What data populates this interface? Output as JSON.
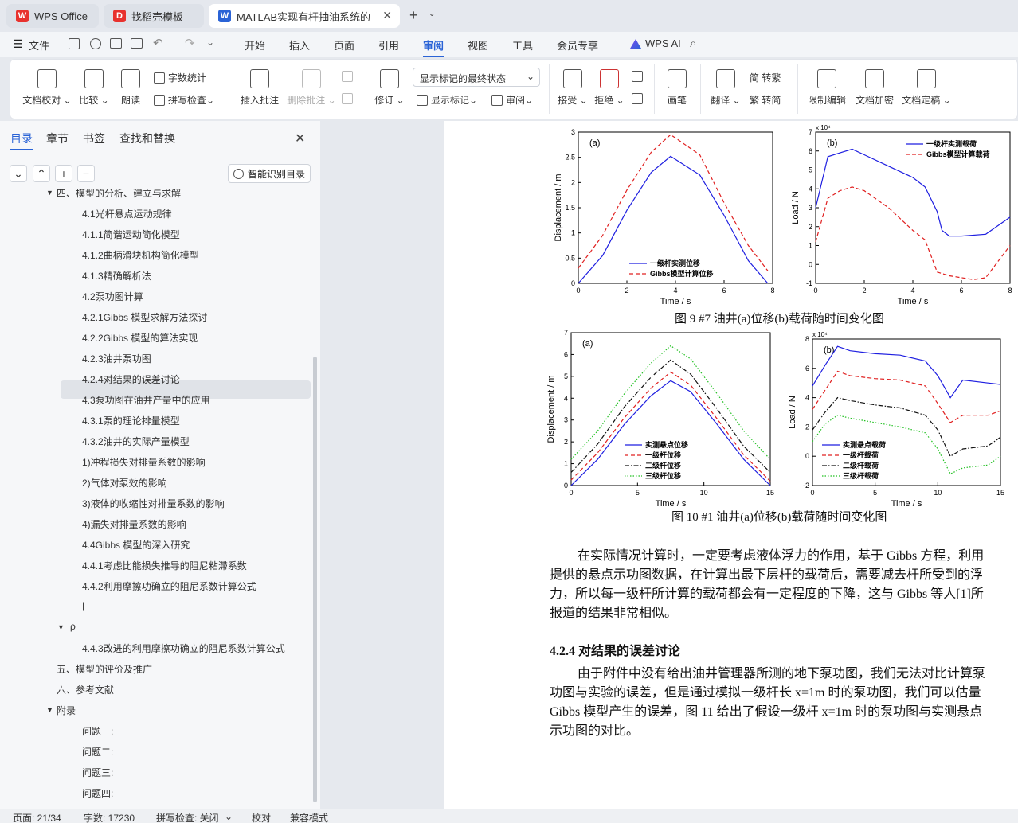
{
  "tabs": [
    {
      "label": "WPS Office",
      "icon": "wps-logo-icon",
      "color": "#e8322e"
    },
    {
      "label": "找稻壳模板",
      "icon": "docer-icon",
      "color": "#e8322e"
    },
    {
      "label": "MATLAB实现有杆抽油系统的",
      "icon": "word-doc-icon",
      "color": "#2a63d6"
    }
  ],
  "menu": {
    "file": "文件",
    "items": [
      "开始",
      "插入",
      "页面",
      "引用",
      "审阅",
      "视图",
      "工具",
      "会员专享"
    ],
    "active": "审阅",
    "ai": "WPS AI"
  },
  "ribbon": {
    "doc_proof": "文档校对",
    "compare": "比较",
    "read_aloud": "朗读",
    "word_count": "字数统计",
    "spell_check": "拼写检查",
    "insert_comment": "插入批注",
    "delete_comment": "删除批注",
    "track": "修订",
    "markup_state": "显示标记的最终状态",
    "show_markup": "显示标记",
    "review": "审阅",
    "accept": "接受",
    "reject": "拒绝",
    "pen": "画笔",
    "translate": "翻译",
    "to_traditional": "简 转繁",
    "to_simplified": "繁 转简",
    "restrict": "限制编辑",
    "encrypt": "文档加密",
    "finalize": "文档定稿"
  },
  "sidebar": {
    "tabs": [
      "目录",
      "章节",
      "书签",
      "查找和替换"
    ],
    "active_tab": "目录",
    "smart_toc": "智能识别目录",
    "items": [
      {
        "label": "四、模型的分析、建立与求解",
        "level": 1,
        "caret": true
      },
      {
        "label": "4.1光杆悬点运动规律",
        "level": 2
      },
      {
        "label": "4.1.1简谐运动简化模型",
        "level": 2
      },
      {
        "label": "4.1.2曲柄滑块机构简化模型",
        "level": 2
      },
      {
        "label": "4.1.3精确解析法",
        "level": 2
      },
      {
        "label": "4.2泵功图计算",
        "level": 2
      },
      {
        "label": "4.2.1Gibbs 模型求解方法探讨",
        "level": 2,
        "selected": true
      },
      {
        "label": "4.2.2Gibbs 模型的算法实现",
        "level": 2
      },
      {
        "label": "4.2.3油井泵功图",
        "level": 2
      },
      {
        "label": "4.2.4对结果的误差讨论",
        "level": 2
      },
      {
        "label": "4.3泵功图在油井产量中的应用",
        "level": 2
      },
      {
        "label": "4.3.1泵的理论排量模型",
        "level": 2
      },
      {
        "label": "4.3.2油井的实际产量模型",
        "level": 2
      },
      {
        "label": "1)冲程损失对排量系数的影响",
        "level": 2
      },
      {
        "label": "2)气体对泵效的影响",
        "level": 2
      },
      {
        "label": "3)液体的收缩性对排量系数的影响",
        "level": 2
      },
      {
        "label": "4)漏失对排量系数的影响",
        "level": 2
      },
      {
        "label": "4.4Gibbs 模型的深入研究",
        "level": 2
      },
      {
        "label": "4.4.1考虑比能损失推导的阻尼粘滞系数",
        "level": 2
      },
      {
        "label": "4.4.2利用摩擦功确立的阻尼系数计算公式",
        "level": 2
      },
      {
        "label": "|",
        "level": 2
      },
      {
        "label": "ρ",
        "level": 1,
        "caret": true
      },
      {
        "label": "4.4.3改进的利用摩擦功确立的阻尼系数计算公式",
        "level": 2
      },
      {
        "label": "五、模型的评价及推广",
        "level": 1
      },
      {
        "label": "六、参考文献",
        "level": 1
      },
      {
        "label": "附录",
        "level": 1,
        "caret": true
      },
      {
        "label": "问题一:",
        "level": 2
      },
      {
        "label": "问题二:",
        "level": 2
      },
      {
        "label": "问题三:",
        "level": 2
      },
      {
        "label": "问题四:",
        "level": 2
      }
    ]
  },
  "document": {
    "fig9_caption": "图  9 #7 油井(a)位移(b)载荷随时间变化图",
    "fig10_caption": "图  10 #1 油井(a)位移(b)载荷随时间变化图",
    "para1": [
      "在实际情况计算时，一定要考虑液体浮力的作用，基于 Gibbs 方程，利用",
      "提供的悬点示功图数据，在计算出最下层杆的载荷后，需要减去杆所受到的浮",
      "力，所以每一级杆所计算的载荷都会有一定程度的下降，这与 Gibbs 等人[1]所",
      "报道的结果非常相似。"
    ],
    "heading": "4.2.4  对结果的误差讨论",
    "para2": [
      "由于附件中没有给出油井管理器所测的地下泵功图，我们无法对比计算泵",
      "功图与实验的误差，但是通过模拟一级杆长 x=1m 时的泵功图，我们可以估量",
      "Gibbs 模型产生的误差，图  11 给出了假设一级杆 x=1m 时的泵功图与实测悬点",
      "示功图的对比。"
    ]
  },
  "chart_data": [
    {
      "type": "line",
      "title": "(a)",
      "xlabel": "Time / s",
      "ylabel": "Displacement / m",
      "xlim": [
        0,
        8
      ],
      "ylim": [
        0,
        3
      ],
      "xticks": [
        0,
        2,
        4,
        6,
        8
      ],
      "yticks": [
        "0",
        "0.5",
        "1",
        "1.5",
        "2",
        "2.5",
        "3"
      ],
      "legend": "lower-center",
      "series": [
        {
          "name": "一级杆实测位移",
          "color": "#1f1fe0",
          "dash": "solid",
          "x": [
            0,
            1,
            2,
            3,
            3.8,
            5,
            6,
            7,
            7.8
          ],
          "y": [
            0,
            0.55,
            1.45,
            2.2,
            2.52,
            2.15,
            1.35,
            0.45,
            0
          ]
        },
        {
          "name": "Gibbs模型计算位移",
          "color": "#e02020",
          "dash": "dashed",
          "x": [
            0,
            1,
            2,
            3,
            3.8,
            5,
            6,
            7,
            7.8
          ],
          "y": [
            0.3,
            0.95,
            1.85,
            2.6,
            2.95,
            2.55,
            1.6,
            0.75,
            0.25
          ]
        }
      ]
    },
    {
      "type": "line",
      "title": "(b)",
      "xlabel": "Time / s",
      "ylabel": "Load / N",
      "yscale": "x 10^4",
      "xlim": [
        0,
        8
      ],
      "ylim": [
        -1,
        7
      ],
      "xticks": [
        0,
        2,
        4,
        6,
        8
      ],
      "yticks": [
        "-1",
        "0",
        "1",
        "2",
        "3",
        "4",
        "5",
        "6",
        "7"
      ],
      "legend": "top-right",
      "series": [
        {
          "name": "一级杆实测载荷",
          "color": "#1f1fe0",
          "dash": "solid",
          "x": [
            0,
            0.5,
            1,
            1.5,
            2,
            3,
            4,
            4.5,
            5,
            5.2,
            5.5,
            6,
            7,
            8
          ],
          "y": [
            3,
            5.7,
            5.9,
            6.1,
            5.8,
            5.2,
            4.6,
            4.1,
            2.8,
            1.8,
            1.5,
            1.5,
            1.6,
            2.5
          ]
        },
        {
          "name": "Gibbs模型计算载荷",
          "color": "#e02020",
          "dash": "dashed",
          "x": [
            0,
            0.5,
            1,
            1.5,
            2,
            3,
            4,
            4.5,
            5,
            5.5,
            6,
            6.5,
            7,
            8
          ],
          "y": [
            1.2,
            3.5,
            3.9,
            4.1,
            3.9,
            3,
            1.8,
            1.3,
            -0.4,
            -0.6,
            -0.7,
            -0.8,
            -0.7,
            1
          ]
        }
      ]
    },
    {
      "type": "line",
      "title": "(a)",
      "xlabel": "Time / s",
      "ylabel": "Displacement / m",
      "xlim": [
        0,
        15
      ],
      "ylim": [
        0,
        7
      ],
      "xticks": [
        0,
        5,
        10,
        15
      ],
      "yticks": [
        "0",
        "1",
        "2",
        "3",
        "4",
        "5",
        "6",
        "7"
      ],
      "legend": "lower-center",
      "series": [
        {
          "name": "实测悬点位移",
          "color": "#1f1fe0",
          "dash": "solid",
          "x": [
            0,
            2,
            4,
            6,
            7.5,
            9,
            11,
            13,
            15
          ],
          "y": [
            0,
            1.2,
            2.8,
            4.1,
            4.8,
            4.3,
            2.8,
            1.2,
            0
          ]
        },
        {
          "name": "一级杆位移",
          "color": "#e02020",
          "dash": "dashed",
          "x": [
            0,
            2,
            4,
            6,
            7.5,
            9,
            11,
            13,
            15
          ],
          "y": [
            0.25,
            1.5,
            3.1,
            4.45,
            5.2,
            4.6,
            3.05,
            1.4,
            0.2
          ]
        },
        {
          "name": "二级杆位移",
          "color": "#111111",
          "dash": "dashdot",
          "x": [
            0,
            2,
            4,
            6,
            7.5,
            9,
            11,
            13,
            15
          ],
          "y": [
            0.6,
            1.9,
            3.6,
            4.95,
            5.75,
            5.1,
            3.5,
            1.8,
            0.6
          ]
        },
        {
          "name": "三级杆位移",
          "color": "#20c020",
          "dash": "dotted",
          "x": [
            0,
            2,
            4,
            6,
            7.5,
            9,
            11,
            13,
            15
          ],
          "y": [
            1.2,
            2.5,
            4.2,
            5.6,
            6.4,
            5.8,
            4.2,
            2.5,
            1.2
          ]
        }
      ]
    },
    {
      "type": "line",
      "title": "(b)",
      "xlabel": "Time / s",
      "ylabel": "Load / N",
      "yscale": "x 10^4",
      "xlim": [
        0,
        15
      ],
      "ylim": [
        -2,
        8
      ],
      "xticks": [
        0,
        5,
        10,
        15
      ],
      "yticks": [
        "-2",
        "0",
        "2",
        "4",
        "6",
        "8"
      ],
      "legend": "lower-left",
      "series": [
        {
          "name": "实测悬点载荷",
          "color": "#1f1fe0",
          "dash": "solid",
          "x": [
            0,
            1,
            2,
            3,
            5,
            7,
            9,
            10,
            11,
            12,
            14,
            15
          ],
          "y": [
            4.8,
            6.2,
            7.5,
            7.2,
            7,
            6.9,
            6.5,
            5.5,
            4,
            5.2,
            5,
            4.9
          ]
        },
        {
          "name": "一级杆载荷",
          "color": "#e02020",
          "dash": "dashed",
          "x": [
            0,
            1,
            2,
            3,
            5,
            7,
            9,
            10,
            11,
            12,
            14,
            15
          ],
          "y": [
            3.2,
            4.5,
            5.8,
            5.5,
            5.3,
            5.2,
            4.8,
            3.6,
            2.3,
            2.8,
            2.8,
            3.1
          ]
        },
        {
          "name": "二级杆载荷",
          "color": "#111111",
          "dash": "dashdot",
          "x": [
            0,
            1,
            2,
            3,
            5,
            7,
            9,
            10,
            11,
            12,
            14,
            15
          ],
          "y": [
            1.8,
            3,
            4,
            3.8,
            3.5,
            3.3,
            2.8,
            1.8,
            0,
            0.5,
            0.7,
            1.3
          ]
        },
        {
          "name": "三级杆载荷",
          "color": "#20c020",
          "dash": "dotted",
          "x": [
            0,
            1,
            2,
            3,
            5,
            7,
            9,
            10,
            11,
            12,
            14,
            15
          ],
          "y": [
            1,
            2.2,
            2.8,
            2.6,
            2.3,
            2,
            1.6,
            0.5,
            -1.2,
            -0.8,
            -0.6,
            0
          ]
        }
      ]
    }
  ],
  "status": {
    "page": "页面: 21/34",
    "words": "字数: 17230",
    "spell": "拼写检查: 关闭",
    "proof": "校对",
    "compat": "兼容模式"
  }
}
